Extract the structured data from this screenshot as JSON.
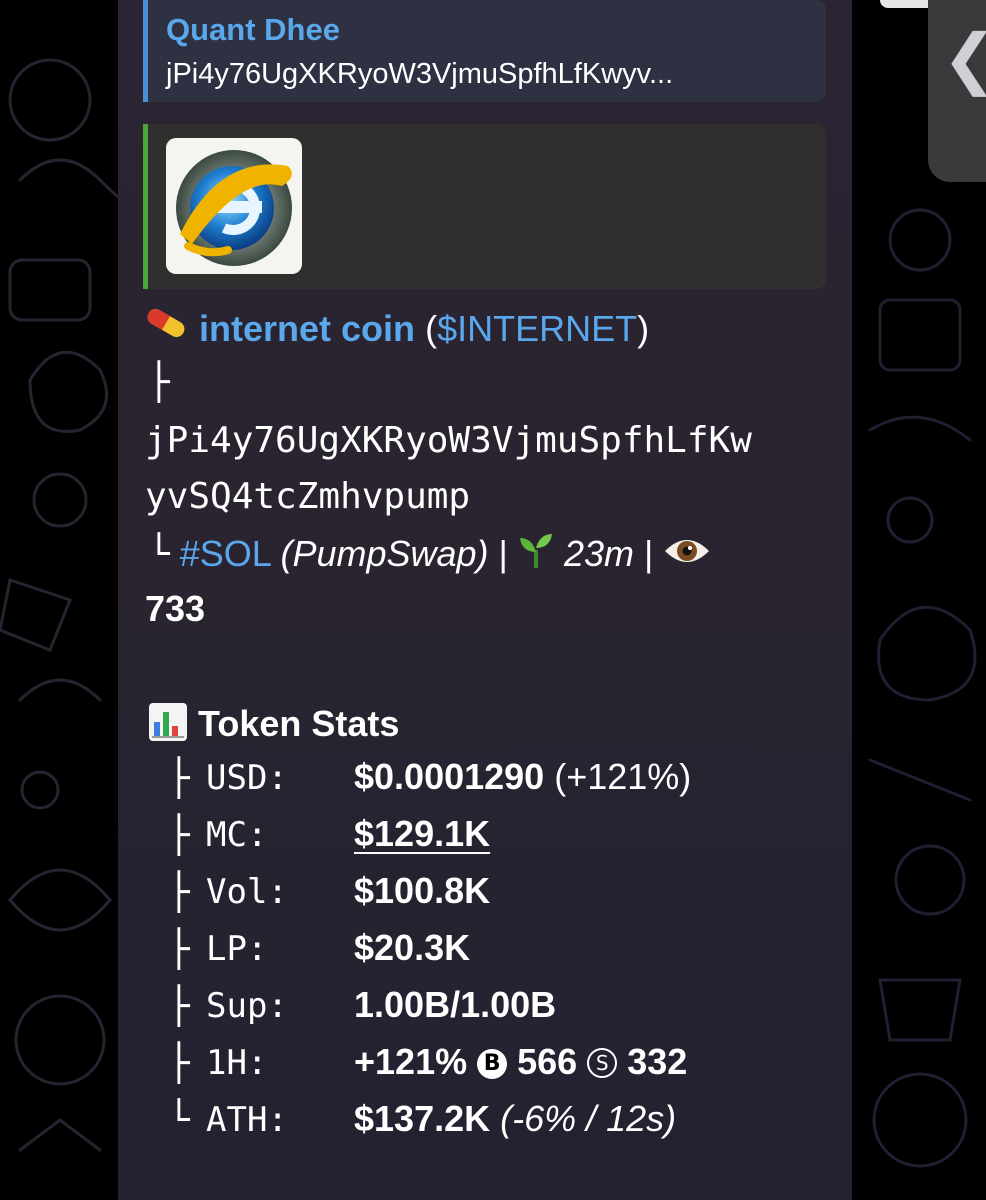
{
  "reply": {
    "name": "Quant Dhee",
    "text": "jPi4y76UgXKRyoW3VjmuSpfhLfKwyv..."
  },
  "token": {
    "name": "internet coin",
    "open_paren": "(",
    "ticker": "$INTERNET",
    "close_paren": ")",
    "address_line1": "jPi4y76UgXKRyoW3VjmuSpfhLfKw",
    "address_line2": "yvSQ4tcZmhvpump",
    "chain": "#SOL",
    "dex": "(PumpSwap)",
    "sep1": "|",
    "age": "23m",
    "sep2": "|",
    "views": "733",
    "tree_branch": "├",
    "tree_end": "└"
  },
  "stats": {
    "title": "Token Stats",
    "rows": [
      {
        "branch": "├",
        "label": "USD:",
        "value": "$0.0001290",
        "extra": "(+121%)"
      },
      {
        "branch": "├",
        "label": "MC:",
        "value": "$129.1K"
      },
      {
        "branch": "├",
        "label": "Vol:",
        "value": "$100.8K"
      },
      {
        "branch": "├",
        "label": "LP:",
        "value": "$20.3K"
      },
      {
        "branch": "├",
        "label": "Sup:",
        "value": "1.00B/1.00B"
      },
      {
        "branch": "├",
        "label": "1H:",
        "value": "+121%",
        "buys_icon": "B",
        "buys": "566",
        "sells_icon": "S",
        "sells": "332"
      },
      {
        "branch": "└",
        "label": "ATH:",
        "value": "$137.2K",
        "extra": "(-6% / 12s)"
      }
    ]
  },
  "icons": {
    "pill": "pill-icon",
    "seedling": "seedling-icon",
    "eye": "eye-icon",
    "chart": "bar-chart-icon",
    "chevron": "chevron-left-icon"
  },
  "colors": {
    "link": "#5aa7ec",
    "reply_bar": "#4a8fd6",
    "preview_bar": "#4aa63b"
  }
}
